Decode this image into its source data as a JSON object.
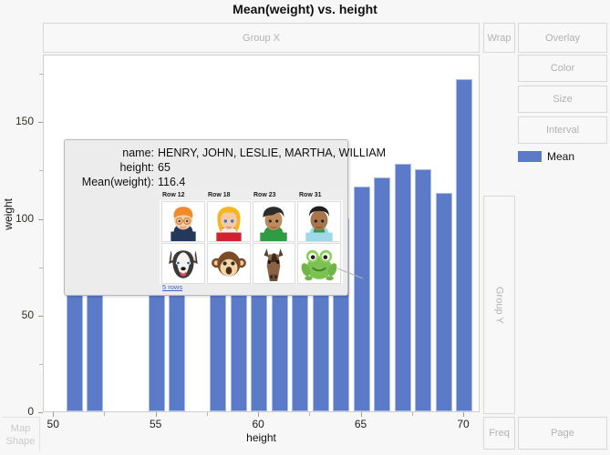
{
  "title": "Mean(weight) vs. height",
  "dropzones": {
    "group_x": "Group X",
    "wrap": "Wrap",
    "overlay": "Overlay",
    "color": "Color",
    "size": "Size",
    "interval": "Interval",
    "group_y": "Group Y",
    "freq": "Freq",
    "page": "Page",
    "map_shape_line1": "Map",
    "map_shape_line2": "Shape"
  },
  "legend": {
    "entries": [
      {
        "label": "Mean",
        "color": "#5b7bc8"
      }
    ]
  },
  "tooltip": {
    "rows": [
      {
        "key": "name:",
        "value": "HENRY, JOHN, LESLIE, MARTHA, WILLIAM"
      },
      {
        "key": "height:",
        "value": "65"
      },
      {
        "key": "Mean(weight):",
        "value": "116.4"
      }
    ],
    "table_headers": [
      "Row 12",
      "Row 18",
      "Row 23",
      "Row 31"
    ],
    "thumbnails_row1": [
      "boy-glasses-avatar",
      "girl-blonde-avatar",
      "boy-dark-hair-avatar",
      "boy-short-hair-avatar"
    ],
    "thumbnails_row2": [
      "husky-dog-avatar",
      "monkey-avatar",
      "horse-avatar",
      "frog-avatar"
    ],
    "rows_link": "5 rows"
  },
  "chart_data": {
    "type": "bar",
    "title": "Mean(weight) vs. height",
    "xlabel": "height",
    "ylabel": "weight",
    "xlim": [
      49.5,
      70.8
    ],
    "ylim": [
      0,
      185
    ],
    "x_ticks": [
      50,
      55,
      60,
      65,
      70
    ],
    "x_minor_ticks": [
      52.5,
      57.5,
      62.5,
      67.5
    ],
    "y_ticks": [
      0,
      50,
      100,
      150
    ],
    "y_minor_ticks": [
      25,
      75,
      125,
      175
    ],
    "grid": false,
    "legend_position": "right",
    "bar_color": "#5b7bc8",
    "series": [
      {
        "name": "Mean",
        "x": [
          51,
          52,
          55,
          56,
          58,
          59,
          60,
          61,
          62,
          63,
          64,
          65,
          66,
          67,
          68,
          69,
          70
        ],
        "values": [
          80,
          62,
          62,
          62,
          62,
          62,
          62,
          62,
          62,
          62,
          100,
          116.4,
          121,
          128,
          125,
          113,
          172
        ]
      }
    ]
  }
}
